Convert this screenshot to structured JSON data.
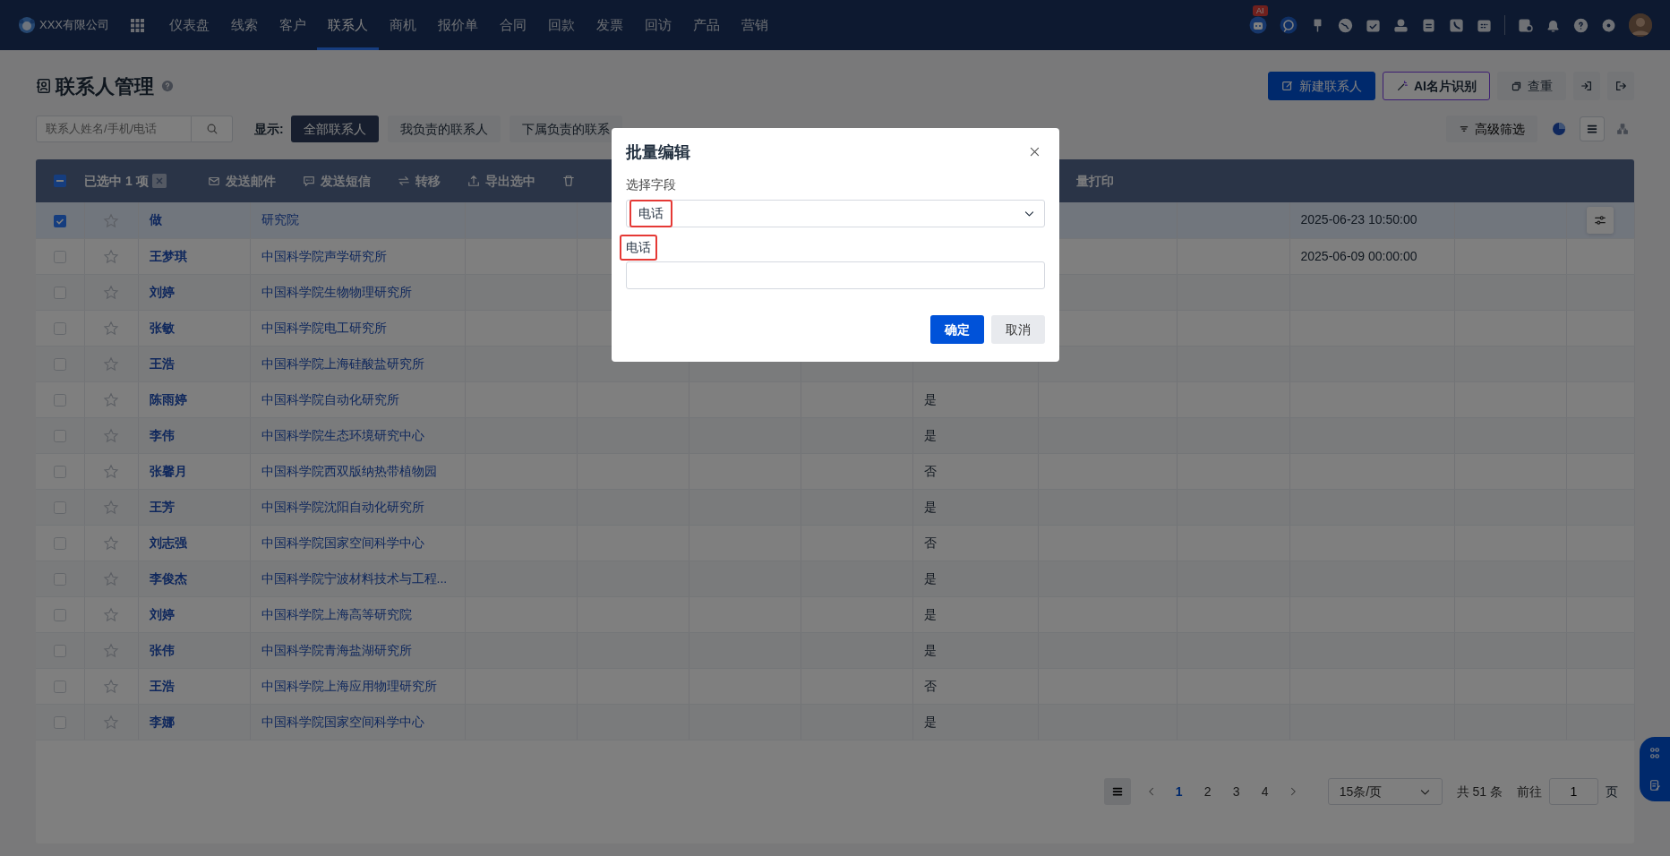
{
  "nav": {
    "company": "XXX有限公司",
    "ai_badge": "AI",
    "menu": [
      {
        "label": "仪表盘",
        "selected": false
      },
      {
        "label": "线索",
        "selected": false
      },
      {
        "label": "客户",
        "selected": false
      },
      {
        "label": "联系人",
        "selected": true
      },
      {
        "label": "商机",
        "selected": false
      },
      {
        "label": "报价单",
        "selected": false
      },
      {
        "label": "合同",
        "selected": false
      },
      {
        "label": "回款",
        "selected": false
      },
      {
        "label": "发票",
        "selected": false
      },
      {
        "label": "回访",
        "selected": false
      },
      {
        "label": "产品",
        "selected": false
      },
      {
        "label": "营销",
        "selected": false
      }
    ]
  },
  "page": {
    "title": "联系人管理"
  },
  "header_buttons": [
    {
      "kind": "primary",
      "label": "新建联系人"
    },
    {
      "kind": "ai",
      "label": "AI名片识别"
    },
    {
      "kind": "plain",
      "label": "查重"
    }
  ],
  "search": {
    "placeholder": "联系人姓名/手机/电话"
  },
  "filter": {
    "label": "显示:",
    "tabs": [
      {
        "label": "全部联系人",
        "selected": true
      },
      {
        "label": "我负责的联系人",
        "selected": false
      },
      {
        "label": "下属负责的联系",
        "selected": false
      }
    ]
  },
  "advanced_filter": "高级筛选",
  "view_modes": [
    {
      "kind": "list",
      "selected": true
    },
    {
      "kind": "tree",
      "selected": false
    }
  ],
  "batch_bar": {
    "indeterminate": true,
    "selected_count": "已选中 1 项",
    "actions": [
      {
        "kind": "mail",
        "label": "发送邮件"
      },
      {
        "kind": "sms",
        "label": "发送短信"
      },
      {
        "kind": "transfer",
        "label": "转移"
      },
      {
        "kind": "export",
        "label": "导出选中"
      },
      {
        "kind": "delete"
      },
      {
        "kind": "print",
        "label": "量打印"
      }
    ]
  },
  "table": {
    "rows": [
      {
        "name": "做",
        "company": "研究院",
        "date": "2025-06-23 10:50:00",
        "selected": true,
        "starred": false
      },
      {
        "name": "王梦琪",
        "company": "中国科学院声学研究所",
        "date": "2025-06-09 00:00:00",
        "selected": false,
        "starred": false
      },
      {
        "name": "刘婷",
        "company": "中国科学院生物物理研究所",
        "selected": false,
        "starred": false
      },
      {
        "name": "张敏",
        "company": "中国科学院电工研究所",
        "selected": false,
        "starred": false
      },
      {
        "name": "王浩",
        "company": "中国科学院上海硅酸盐研究所",
        "selected": false,
        "starred": false
      },
      {
        "name": "陈雨婷",
        "company": "中国科学院自动化研究所",
        "flag": "是",
        "selected": false,
        "starred": false
      },
      {
        "name": "李伟",
        "company": "中国科学院生态环境研究中心",
        "flag": "是",
        "selected": false,
        "starred": false
      },
      {
        "name": "张馨月",
        "company": "中国科学院西双版纳热带植物园",
        "flag": "否",
        "selected": false,
        "starred": false
      },
      {
        "name": "王芳",
        "company": "中国科学院沈阳自动化研究所",
        "flag": "是",
        "selected": false,
        "starred": false
      },
      {
        "name": "刘志强",
        "company": "中国科学院国家空间科学中心",
        "flag": "否",
        "selected": false,
        "starred": false
      },
      {
        "name": "李俊杰",
        "company": "中国科学院宁波材料技术与工程...",
        "flag": "是",
        "selected": false,
        "starred": false
      },
      {
        "name": "刘婷",
        "company": "中国科学院上海高等研究院",
        "flag": "是",
        "selected": false,
        "starred": false
      },
      {
        "name": "张伟",
        "company": "中国科学院青海盐湖研究所",
        "flag": "是",
        "selected": false,
        "starred": false
      },
      {
        "name": "王浩",
        "company": "中国科学院上海应用物理研究所",
        "flag": "否",
        "selected": false,
        "starred": false
      },
      {
        "name": "李娜",
        "company": "中国科学院国家空间科学中心",
        "flag": "是",
        "selected": false,
        "starred": false
      }
    ]
  },
  "pagination": {
    "pages": [
      {
        "label": "1",
        "selected": true
      },
      {
        "label": "2",
        "selected": false
      },
      {
        "label": "3",
        "selected": false
      },
      {
        "label": "4",
        "selected": false
      }
    ],
    "page_size": "15条/页",
    "total": "共 51 条",
    "goto_label": "前往",
    "goto_value": "1",
    "goto_unit": "页"
  },
  "dialog": {
    "title": "批量编辑",
    "field_label": "选择字段",
    "field_value": "电话",
    "field_value_highlighted": true,
    "input_label": "电话",
    "input_label_highlighted": true,
    "buttons": [
      {
        "kind": "primary",
        "label": "确定"
      },
      {
        "kind": "secondary",
        "label": "取消"
      }
    ]
  }
}
